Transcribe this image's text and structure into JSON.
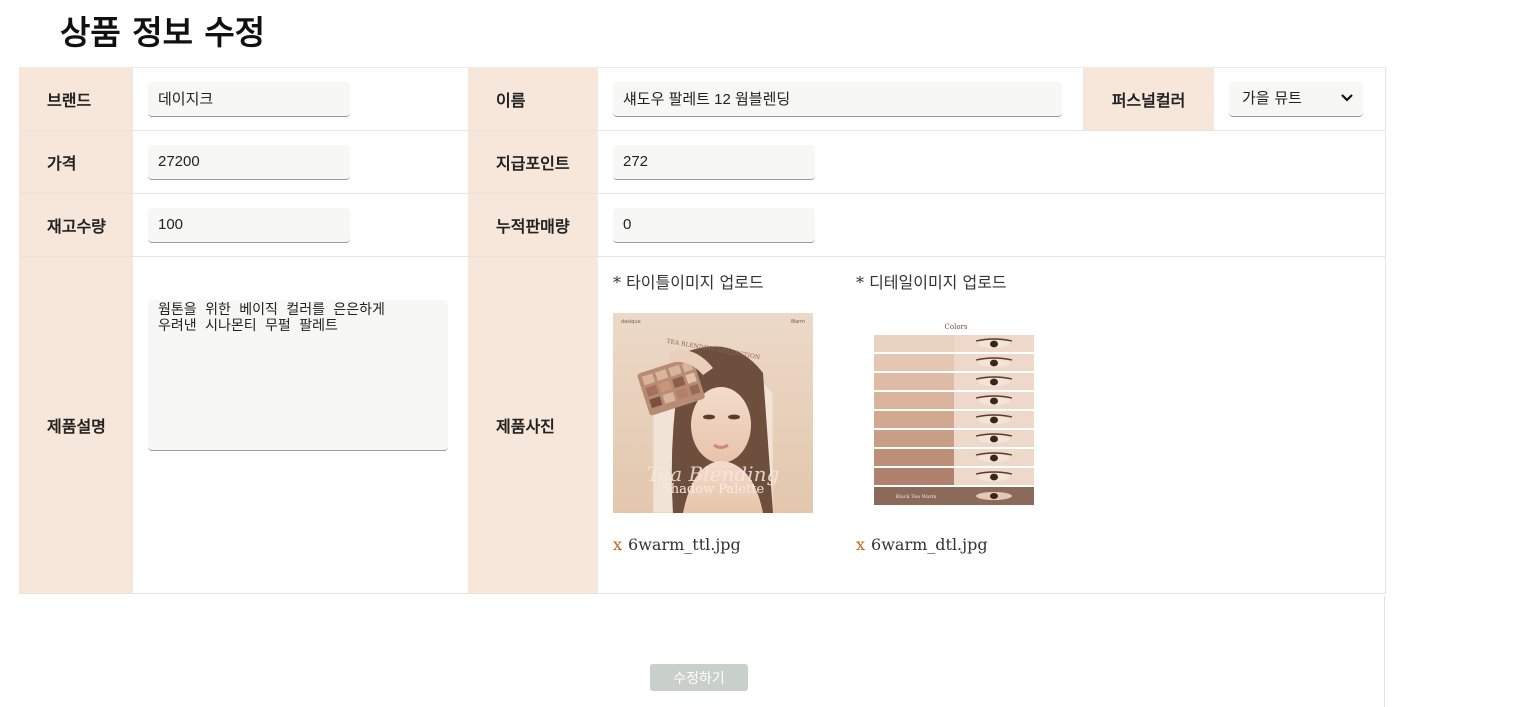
{
  "page": {
    "title": "상품 정보 수정"
  },
  "fields": {
    "brand": {
      "label": "브랜드",
      "value": "데이지크"
    },
    "name": {
      "label": "이름",
      "value": "섀도우 팔레트 12 웜블렌딩"
    },
    "personal_color": {
      "label": "퍼스널컬러",
      "value": "가을 뮤트"
    },
    "price": {
      "label": "가격",
      "value": "27200"
    },
    "points": {
      "label": "지급포인트",
      "value": "272"
    },
    "stock": {
      "label": "재고수량",
      "value": "100"
    },
    "sold": {
      "label": "누적판매량",
      "value": "0"
    },
    "description": {
      "label": "제품설명",
      "value": "웜톤을 위한 베이직 컬러를 은은하게\n우려낸 시나몬티 무펄 팔레트"
    },
    "photos": {
      "label": "제품사진",
      "title_upload_label": "* 타이틀이미지 업로드",
      "detail_upload_label": "* 디테일이미지 업로드",
      "title_file": "6warm_ttl.jpg",
      "detail_file": "6warm_dtl.jpg",
      "remove_glyph": "x"
    }
  },
  "poster": {
    "collection": "TEA BLENDING COLLECTION",
    "script": "Tea Blending",
    "subtitle": "Shadow Palette",
    "brand_left": "dasique",
    "brand_right": "Warm"
  },
  "swatch": {
    "heading": "Colors",
    "footer": "Black Tea Warm"
  },
  "actions": {
    "submit": "수정하기"
  }
}
